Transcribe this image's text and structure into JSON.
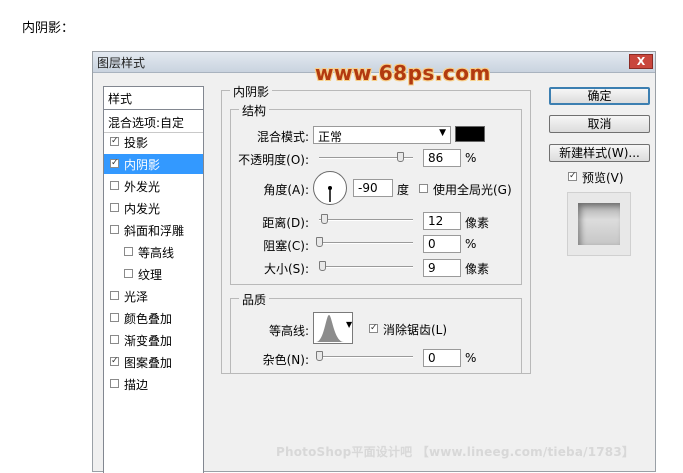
{
  "page_heading": "内阴影：",
  "dialog": {
    "title": "图层样式",
    "close": "X",
    "watermark": "www.68ps.com",
    "footer_watermark": "PhotoShop平面设计吧 【www.lineeg.com/tieba/1783】"
  },
  "left_panel": {
    "header": "样式",
    "blend_options": "混合选项:自定",
    "items": [
      {
        "label": "投影",
        "checked": true,
        "selected": false,
        "indent": false
      },
      {
        "label": "内阴影",
        "checked": true,
        "selected": true,
        "indent": false
      },
      {
        "label": "外发光",
        "checked": false,
        "selected": false,
        "indent": false
      },
      {
        "label": "内发光",
        "checked": false,
        "selected": false,
        "indent": false
      },
      {
        "label": "斜面和浮雕",
        "checked": false,
        "selected": false,
        "indent": false
      },
      {
        "label": "等高线",
        "checked": false,
        "selected": false,
        "indent": true
      },
      {
        "label": "纹理",
        "checked": false,
        "selected": false,
        "indent": true
      },
      {
        "label": "光泽",
        "checked": false,
        "selected": false,
        "indent": false
      },
      {
        "label": "颜色叠加",
        "checked": false,
        "selected": false,
        "indent": false
      },
      {
        "label": "渐变叠加",
        "checked": false,
        "selected": false,
        "indent": false
      },
      {
        "label": "图案叠加",
        "checked": true,
        "selected": false,
        "indent": false
      },
      {
        "label": "描边",
        "checked": false,
        "selected": false,
        "indent": false
      }
    ]
  },
  "buttons": {
    "ok": "确定",
    "cancel": "取消",
    "new_style": "新建样式(W)...",
    "preview_label": "预览(V)",
    "preview_checked": true
  },
  "inner_shadow": {
    "section_title": "内阴影",
    "structure_title": "结构",
    "blend_mode_label": "混合模式:",
    "blend_mode_value": "正常",
    "color": "#000000",
    "opacity_label": "不透明度(O):",
    "opacity_value": "86",
    "opacity_unit": "%",
    "opacity_level": 0.86,
    "angle_label": "角度(A):",
    "angle_value": "-90",
    "angle_unit": "度",
    "global_light_label": "使用全局光(G)",
    "global_light_checked": false,
    "distance_label": "距离(D):",
    "distance_value": "12",
    "distance_unit": "像素",
    "distance_level": 0.048,
    "choke_label": "阻塞(C):",
    "choke_value": "0",
    "choke_unit": "%",
    "choke_level": 0,
    "size_label": "大小(S):",
    "size_value": "9",
    "size_unit": "像素",
    "size_level": 0.036
  },
  "quality": {
    "title": "品质",
    "contour_label": "等高线:",
    "anti_alias_label": "消除锯齿(L)",
    "anti_alias_checked": true,
    "noise_label": "杂色(N):",
    "noise_value": "0",
    "noise_unit": "%",
    "noise_level": 0
  }
}
